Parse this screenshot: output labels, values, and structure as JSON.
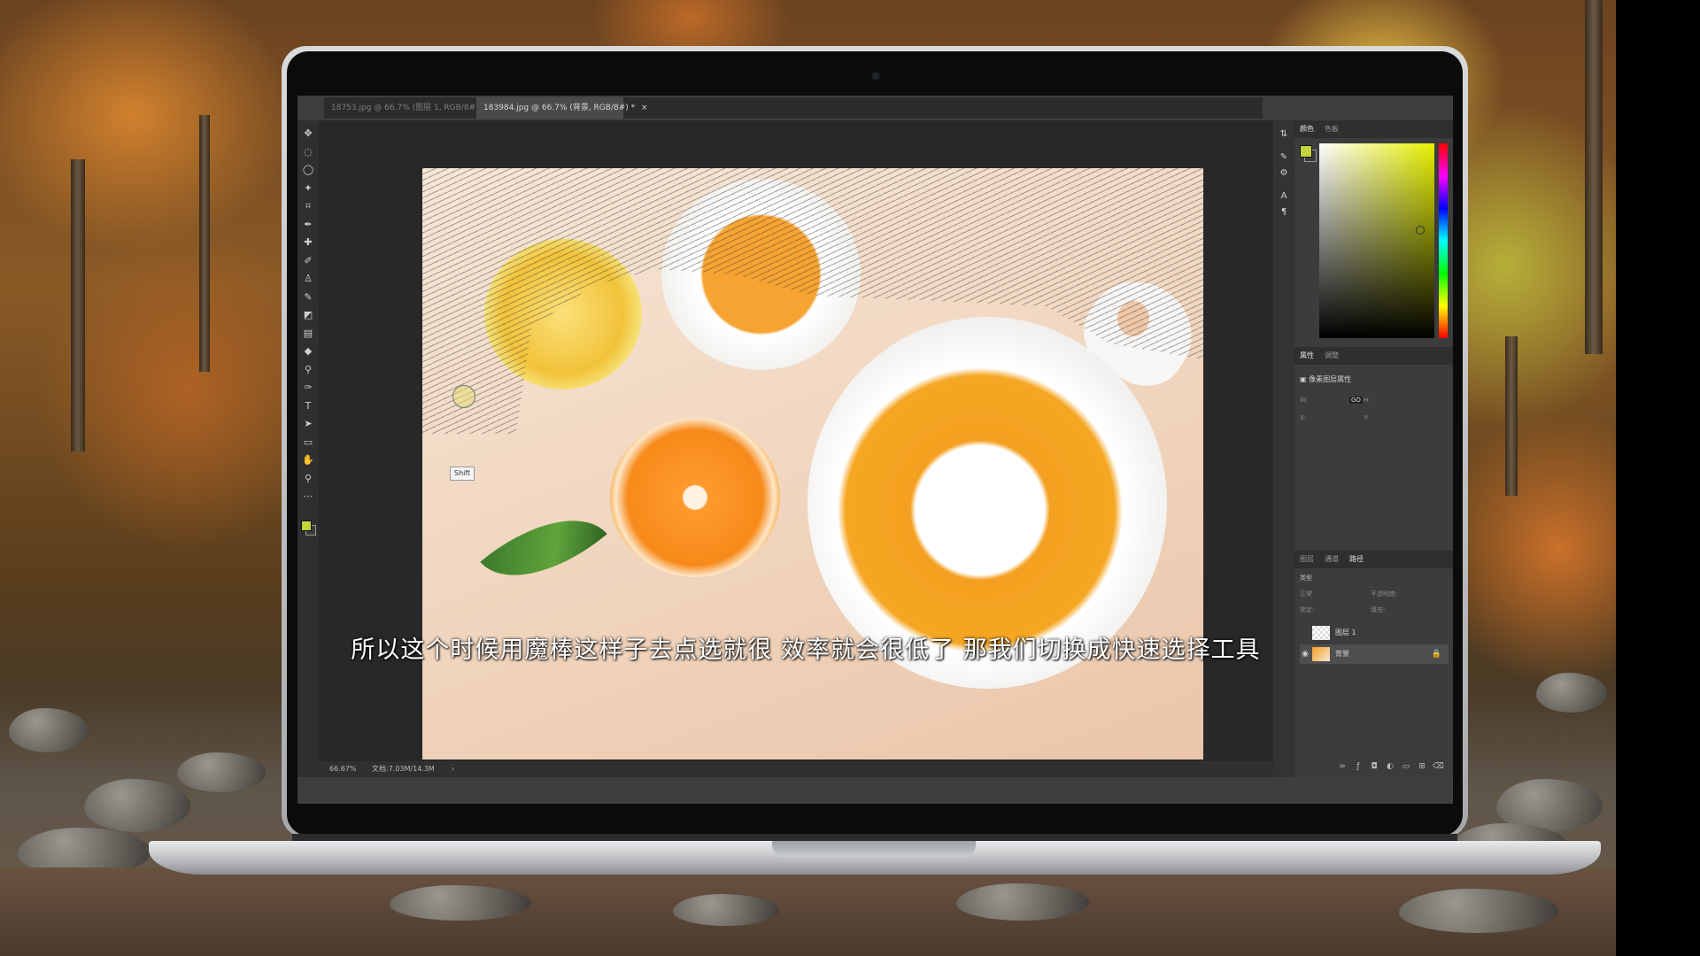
{
  "tabs": [
    {
      "label": "18753.jpg @ 66.7% (图层 1, RGB/8#) *",
      "close": "×"
    },
    {
      "label": "183984.jpg @ 66.7% (背景, RGB/8#) *",
      "close": "×"
    }
  ],
  "status": {
    "zoom": "66.67%",
    "doc": "文档:7.03M/14.3M",
    "arrow": "›"
  },
  "tooltip": "Shift",
  "subtitle": "所以这个时候用魔棒这样子去点选就很  效率就会很低了  那我们切换成快速选择工具",
  "color_panel": {
    "tabs": [
      "颜色",
      "色板"
    ],
    "foreground": "#c2d43a",
    "background": "#3b3b3b"
  },
  "properties_panel": {
    "tabs": [
      "属性",
      "调整"
    ],
    "title": "像素图层属性",
    "fields": {
      "w_label": "W:",
      "h_label": "H:",
      "x_label": "X:",
      "y_label": "Y:",
      "link": "GO"
    }
  },
  "layers_panel": {
    "tabs": [
      "图层",
      "通道",
      "路径"
    ],
    "filter": "类型",
    "blend": "正常",
    "opacity_label": "不透明度:",
    "lock_label": "锁定:",
    "fill_label": "填充:",
    "layers": [
      {
        "name": "图层 1",
        "visible": false,
        "locked": false
      },
      {
        "name": "背景",
        "visible": true,
        "locked": true
      }
    ]
  },
  "tools": [
    "move-tool-icon",
    "marquee-tool-icon",
    "lasso-tool-icon",
    "quick-select-tool-icon",
    "crop-tool-icon",
    "eyedropper-tool-icon",
    "healing-tool-icon",
    "brush-tool-icon",
    "stamp-tool-icon",
    "history-brush-icon",
    "eraser-tool-icon",
    "gradient-tool-icon",
    "blur-tool-icon",
    "dodge-tool-icon",
    "pen-tool-icon",
    "type-tool-icon",
    "path-select-icon",
    "shape-tool-icon",
    "hand-tool-icon",
    "zoom-tool-icon",
    "more-tools-icon"
  ]
}
